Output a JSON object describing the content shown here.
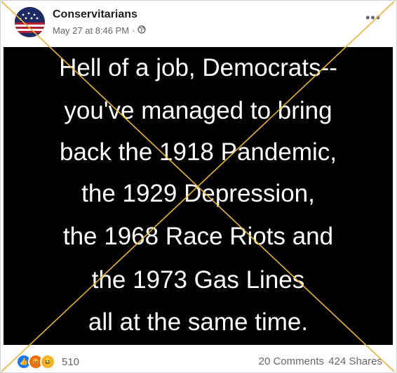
{
  "post": {
    "page_name": "Conservitarians",
    "timestamp": "May 27 at 8:46 PM",
    "separator": "·",
    "audience_icon": "globe-icon",
    "more_icon": "ellipsis-icon"
  },
  "meme": {
    "lines": [
      "Hell of a job, Democrats--",
      "you've managed to bring",
      "back the 1918 Pandemic,",
      "the 1929 Depression,",
      "the 1968 Race Riots and",
      "the 1973 Gas Lines",
      "all at the same time."
    ]
  },
  "engagement": {
    "reaction_icons": [
      "like-icon",
      "angry-icon",
      "haha-icon"
    ],
    "reaction_count": "510",
    "comments": "20 Comments",
    "shares": "424 Shares"
  },
  "overlay": {
    "type": "fact-check-x",
    "color": "#e8b33a"
  }
}
